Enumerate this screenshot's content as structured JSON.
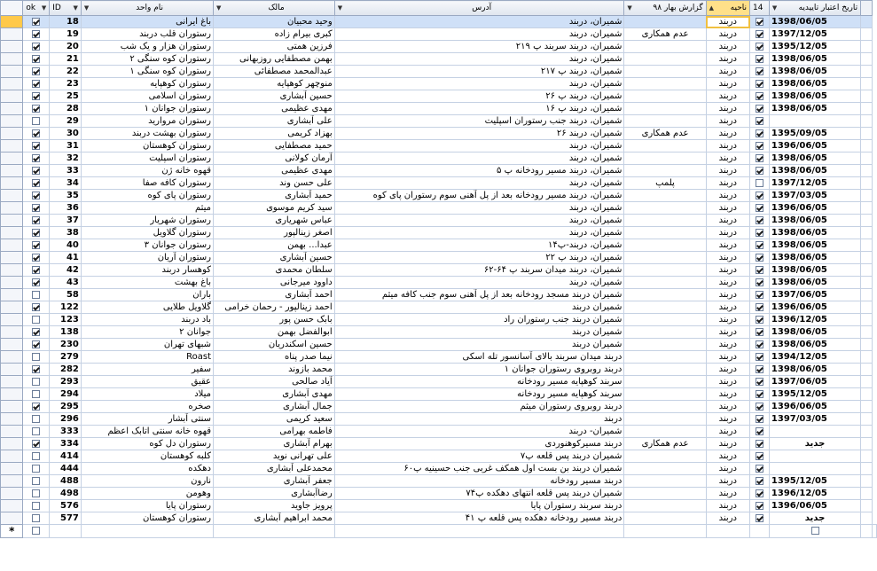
{
  "headers": {
    "ok": "ok",
    "id": "ID",
    "name": "نام واحد",
    "owner": "مالک",
    "address": "آدرس",
    "report": "گزارش بهار ۹۸",
    "area": "ناحیه",
    "c14": "14",
    "date": "تاریخ اعتبار تاییدیه"
  },
  "rows": [
    {
      "ok": true,
      "id": "18",
      "name": "باغ ایرانی",
      "owner": "وحید محبیان",
      "address": "شمیران، دربند",
      "report": "",
      "area": "دربند",
      "c14": true,
      "date": "1398/06/05"
    },
    {
      "ok": true,
      "id": "19",
      "name": "رستوران قلب دربند",
      "owner": "کبری بیرام زاده",
      "address": "شمیران، دربند",
      "report": "عدم همکاری",
      "area": "دربند",
      "c14": true,
      "date": "1397/12/05"
    },
    {
      "ok": true,
      "id": "20",
      "name": "رستوران هزار و یک شب",
      "owner": "فرزین همتی",
      "address": "شمیران، دربند سربند پ ۲۱۹",
      "report": "",
      "area": "دربند",
      "c14": true,
      "date": "1395/12/05"
    },
    {
      "ok": true,
      "id": "21",
      "name": "رستوران کوه سنگی ۲",
      "owner": "بهمن مصطفایی روزبهانی",
      "address": "شمیران، دربند",
      "report": "",
      "area": "دربند",
      "c14": true,
      "date": "1398/06/05"
    },
    {
      "ok": true,
      "id": "22",
      "name": "رستوران کوه سنگی ۱",
      "owner": "عبدالمحمد مصطفائی",
      "address": "شمیران، دربند پ ۲۱۷",
      "report": "",
      "area": "دربند",
      "c14": true,
      "date": "1398/06/05"
    },
    {
      "ok": true,
      "id": "23",
      "name": "رستوران کوهپایه",
      "owner": "منوچهر کوهپایه",
      "address": "شمیران، دربند",
      "report": "",
      "area": "دربند",
      "c14": true,
      "date": "1398/06/05"
    },
    {
      "ok": true,
      "id": "25",
      "name": "رستوران اسلامی",
      "owner": "حسین آبشاری",
      "address": "شمیران، دربند پ ۲۶",
      "report": "",
      "area": "دربند",
      "c14": true,
      "date": "1398/06/05"
    },
    {
      "ok": true,
      "id": "28",
      "name": "رستوران جوانان ۱",
      "owner": "مهدی عظیمی",
      "address": "شمیران، دربند پ ۱۶",
      "report": "",
      "area": "دربند",
      "c14": true,
      "date": "1398/06/05"
    },
    {
      "ok": false,
      "id": "29",
      "name": "رستوران مروارید",
      "owner": "علی آبشاری",
      "address": "شمیران، دربند جنب رستوران اسپلیت",
      "report": "",
      "area": "دربند",
      "c14": true,
      "date": ""
    },
    {
      "ok": true,
      "id": "30",
      "name": "رستوران بهشت دربند",
      "owner": "بهزاد کریمی",
      "address": "شمیران، دربند ۲۶",
      "report": "عدم همکاری",
      "area": "دربند",
      "c14": true,
      "date": "1395/09/05"
    },
    {
      "ok": true,
      "id": "31",
      "name": "رستوران کوهستان",
      "owner": "حمید مصطفایی",
      "address": "شمیران، دربند",
      "report": "",
      "area": "دربند",
      "c14": true,
      "date": "1396/06/05"
    },
    {
      "ok": true,
      "id": "32",
      "name": "رستوران اسپلیت",
      "owner": "آرمان کولانی",
      "address": "شمیران، دربند",
      "report": "",
      "area": "دربند",
      "c14": true,
      "date": "1398/06/05"
    },
    {
      "ok": true,
      "id": "33",
      "name": "قهوه خانه ژن",
      "owner": "مهدی عظیمی",
      "address": "شمیران، دربند مسیر رودخانه پ ۵",
      "report": "",
      "area": "دربند",
      "c14": true,
      "date": "1398/06/05"
    },
    {
      "ok": true,
      "id": "34",
      "name": "رستوران کافه صفا",
      "owner": "علی حسن وند",
      "address": "شمیران، دربند",
      "report": "پلمپ",
      "area": "دربند",
      "c14": false,
      "date": "1397/12/05"
    },
    {
      "ok": true,
      "id": "35",
      "name": "رستوران پای کوه",
      "owner": "حمید آبشاری",
      "address": "شمیران، دربند مسیر رودخانه بعد از پل آهنی سوم رستوران پای کوه",
      "report": "",
      "area": "دربند",
      "c14": true,
      "date": "1397/03/05"
    },
    {
      "ok": true,
      "id": "36",
      "name": "میثم",
      "owner": "سید کریم موسوی",
      "address": "شمیران، دربند",
      "report": "",
      "area": "دربند",
      "c14": true,
      "date": "1396/06/05"
    },
    {
      "ok": true,
      "id": "37",
      "name": "رستوران شهریار",
      "owner": "عباس شهریاری",
      "address": "شمیران، دربند",
      "report": "",
      "area": "دربند",
      "c14": true,
      "date": "1398/06/05"
    },
    {
      "ok": true,
      "id": "38",
      "name": "رستوران گلاویل",
      "owner": "اصغر زینالپور",
      "address": "شمیران، دربند",
      "report": "",
      "area": "دربند",
      "c14": true,
      "date": "1398/06/05"
    },
    {
      "ok": true,
      "id": "40",
      "name": "رستوران جوانان ۳",
      "owner": "عبدا... بهمن",
      "address": "شمیران، دربند-پ۱۴",
      "report": "",
      "area": "دربند",
      "c14": true,
      "date": "1398/06/05"
    },
    {
      "ok": true,
      "id": "41",
      "name": "رستوران آریان",
      "owner": "حسین آبشاری",
      "address": "شمیران، دربند پ ۲۲",
      "report": "",
      "area": "دربند",
      "c14": true,
      "date": "1398/06/05"
    },
    {
      "ok": true,
      "id": "42",
      "name": "کوهسار دربند",
      "owner": "سلطان محمدی",
      "address": "شمیران، دربند میدان سربند پ ۶۴-۶۲",
      "report": "",
      "area": "دربند",
      "c14": true,
      "date": "1398/06/05"
    },
    {
      "ok": true,
      "id": "43",
      "name": "باغ بهشت",
      "owner": "داوود میرجانی",
      "address": "شمیران، دربند",
      "report": "",
      "area": "دربند",
      "c14": true,
      "date": "1398/06/05"
    },
    {
      "ok": false,
      "id": "58",
      "name": "باران",
      "owner": "احمد آبشاری",
      "address": "شمیران دربند مسجد رودخانه بعد از پل آهنی سوم جنب کافه میثم",
      "report": "",
      "area": "دربند",
      "c14": true,
      "date": "1397/06/05"
    },
    {
      "ok": true,
      "id": "122",
      "name": "گلاویل طلایی",
      "owner": "احمد زینالپور - رحمان خرامی",
      "address": "شمیران دربند",
      "report": "",
      "area": "دربند",
      "c14": true,
      "date": "1396/06/05"
    },
    {
      "ok": false,
      "id": "123",
      "name": "باد دربند",
      "owner": "بابک حسن پور",
      "address": "شمیران دربند جنب رستوران راد",
      "report": "",
      "area": "دربند",
      "c14": true,
      "date": "1396/12/05"
    },
    {
      "ok": true,
      "id": "138",
      "name": "جوانان ۲",
      "owner": "ابوالفضل بهمن",
      "address": "شمیران دربند",
      "report": "",
      "area": "دربند",
      "c14": true,
      "date": "1398/06/05"
    },
    {
      "ok": true,
      "id": "230",
      "name": "شبهای تهران",
      "owner": "حسین اسکندریان",
      "address": "شمیران دربند",
      "report": "",
      "area": "دربند",
      "c14": true,
      "date": "1398/06/05"
    },
    {
      "ok": false,
      "id": "279",
      "name": "Roast",
      "owner": "نیما صدر پناه",
      "address": "دربند میدان سربند بالای آسانسور تله اسکی",
      "report": "",
      "area": "دربند",
      "c14": true,
      "date": "1394/12/05"
    },
    {
      "ok": true,
      "id": "282",
      "name": "سفیر",
      "owner": "محمد بازوند",
      "address": "دربند روبروی رستوران جوانان ۱",
      "report": "",
      "area": "دربند",
      "c14": true,
      "date": "1398/06/05"
    },
    {
      "ok": false,
      "id": "293",
      "name": "عقیق",
      "owner": "آیاد صالحی",
      "address": "سربند کوهپایه مسیر رودخانه",
      "report": "",
      "area": "دربند",
      "c14": true,
      "date": "1397/06/05"
    },
    {
      "ok": false,
      "id": "294",
      "name": "میلاد",
      "owner": "مهدی آبشاری",
      "address": "سربند کوهپایه مسیر رودخانه",
      "report": "",
      "area": "دربند",
      "c14": true,
      "date": "1395/12/05"
    },
    {
      "ok": true,
      "id": "295",
      "name": "صخره",
      "owner": "جمال آبشاری",
      "address": "دربند روبروی رستوران میثم",
      "report": "",
      "area": "دربند",
      "c14": true,
      "date": "1396/06/05"
    },
    {
      "ok": false,
      "id": "296",
      "name": "سنتی آبشار",
      "owner": "سعید کریمی",
      "address": "دربند",
      "report": "",
      "area": "دربند",
      "c14": true,
      "date": "1397/03/05"
    },
    {
      "ok": false,
      "id": "333",
      "name": "قهوه خانه سنتی اتابک اعظم",
      "owner": "فاطمه بهرامی",
      "address": "شمیران- دربند",
      "report": "",
      "area": "دربند",
      "c14": true,
      "date": ""
    },
    {
      "ok": true,
      "id": "334",
      "name": "رستوران دل کوه",
      "owner": "بهرام آبشاری",
      "address": "دربند مسیرکوهنوردی",
      "report": "عدم همکاری",
      "area": "دربند",
      "c14": true,
      "date": "جدید"
    },
    {
      "ok": false,
      "id": "414",
      "name": "کلبه کوهستان",
      "owner": "علی تهرانی نوید",
      "address": "شمیران دربند پس قلعه پ۷",
      "report": "",
      "area": "دربند",
      "c14": true,
      "date": ""
    },
    {
      "ok": false,
      "id": "444",
      "name": "دهکده",
      "owner": "محمدعلی آبشاری",
      "address": "شمیران دربند بن بست اول همکف غربی جنب حسینیه پ۶۰",
      "report": "",
      "area": "دربند",
      "c14": true,
      "date": ""
    },
    {
      "ok": false,
      "id": "488",
      "name": "نارون",
      "owner": "جعفر آبشاری",
      "address": "دربند مسیر رودخانه",
      "report": "",
      "area": "دربند",
      "c14": true,
      "date": "1395/12/05"
    },
    {
      "ok": false,
      "id": "498",
      "name": "وهومن",
      "owner": "رضاآبشاری",
      "address": "شمیران دربند پس قلعه انتهای دهکده پ۷۴",
      "report": "",
      "area": "دربند",
      "c14": true,
      "date": "1396/12/05"
    },
    {
      "ok": false,
      "id": "576",
      "name": "رستوران پایا",
      "owner": "پرویز جاوید",
      "address": "دربند سربند رستوران پایا",
      "report": "",
      "area": "دربند",
      "c14": true,
      "date": "1396/06/05"
    },
    {
      "ok": false,
      "id": "577",
      "name": "رستوران کوهستان",
      "owner": "محمد ابراهیم آبشاری",
      "address": "دربند مسیر رودخانه دهکده پس قلعه پ ۴۱",
      "report": "",
      "area": "دربند",
      "c14": true,
      "date": "جدید"
    }
  ],
  "new_row_marker": "*"
}
